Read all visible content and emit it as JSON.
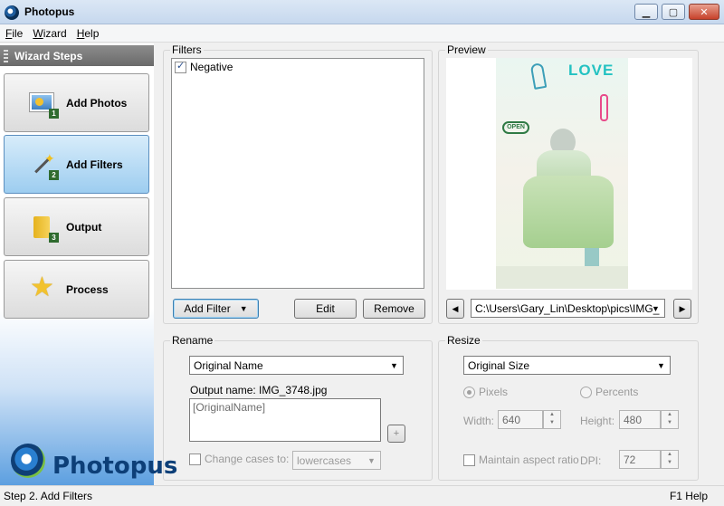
{
  "window": {
    "title": "Photopus"
  },
  "menu": [
    "File",
    "Wizard",
    "Help"
  ],
  "sidebar": {
    "header": "Wizard Steps",
    "steps": [
      {
        "label": "Add Photos",
        "icon": "photos-icon",
        "num": "1"
      },
      {
        "label": "Add Filters",
        "icon": "magic-wand-icon",
        "num": "2"
      },
      {
        "label": "Output",
        "icon": "folder-icon",
        "num": "3"
      },
      {
        "label": "Process",
        "icon": "star-icon",
        "num": ""
      }
    ],
    "logo_text": "Photopus"
  },
  "filters": {
    "label": "Filters",
    "items": [
      {
        "name": "Negative",
        "checked": true
      }
    ],
    "add_filter_label": "Add Filter",
    "edit_label": "Edit",
    "remove_label": "Remove"
  },
  "preview": {
    "label": "Preview",
    "path": "C:\\Users\\Gary_Lin\\Desktop\\pics\\IMG_",
    "prev_label": "◀",
    "next_label": "▶",
    "image_text": {
      "love": "LOVE",
      "open": "OPEN"
    }
  },
  "rename": {
    "label": "Rename",
    "mode": "Original Name",
    "output_name": "Output name: IMG_3748.jpg",
    "pattern": "[OriginalName]",
    "insert_label": "+",
    "change_cases_label": "Change cases to:",
    "cases_value": "lowercases"
  },
  "resize": {
    "label": "Resize",
    "mode": "Original Size",
    "pixels_label": "Pixels",
    "percents_label": "Percents",
    "width_label": "Width:",
    "width_value": "640",
    "height_label": "Height:",
    "height_value": "480",
    "aspect_label": "Maintain aspect ratio",
    "dpi_label": "DPI:",
    "dpi_value": "72"
  },
  "status": {
    "left": "Step 2. Add Filters",
    "right": "F1 Help"
  },
  "colors": {
    "active_step": "#9dcdf0",
    "brand": "#0d3f78"
  }
}
